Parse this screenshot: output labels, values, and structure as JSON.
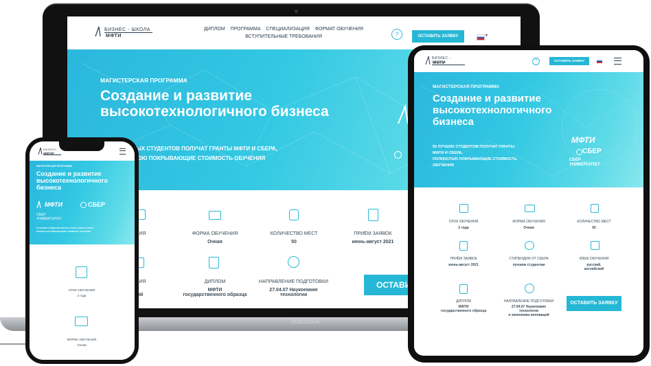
{
  "laptop": {
    "brand_label": "MacBook",
    "logo": {
      "line1": "БИЗНЕС - ШКОЛА",
      "line2": "МФТИ"
    },
    "nav": {
      "row1": [
        "ДИПЛОМ",
        "ПРОГРАММА",
        "СПЕЦИАЛИЗАЦИЯ",
        "ФОРМАТ ОБУЧЕНИЯ"
      ],
      "row2": [
        "ВСТУПИТЕЛЬНЫЕ ТРЕБОВАНИЯ"
      ]
    },
    "help_label": "?",
    "cta_label": "ОСТАВИТЬ ЗАЯВКУ",
    "program_label": "МАГИСТЕРСКАЯ ПРОГРАММА",
    "title_line1": "Создание и развитие",
    "title_line2": "высокотехнологичного бизнеса",
    "grants_line1": "ЫХ СТУДЕНТОВ ПОЛУЧАТ ГРАНТЫ МФТИ И СБЕРА,",
    "grants_line2": "ЮЮ ПОКРЫВАЮЩИЕ СТОИМОСТЬ ОБУЧЕНИЯ",
    "stats_row1": [
      {
        "label": "ЧЕНИЯ",
        "value": "да"
      },
      {
        "label": "ФОРМА ОБУЧЕНИЯ",
        "value": "Очная"
      },
      {
        "label": "КОЛИЧЕСТВО МЕСТ",
        "value": "50"
      },
      {
        "label": "ПРИЁМ ЗАЯВОК",
        "value": "июнь-август 2021"
      }
    ],
    "stats_row2": [
      {
        "label": "ЧЕНИЯ",
        "value": "кий,\nйский"
      },
      {
        "label": "ДИПЛОМ",
        "value": "МФТИ\nгосударственного образца"
      },
      {
        "label": "НАПРАВЛЕНИЕ ПОДГОТОВКИ",
        "value": "27.04.07 Наукоемкие\nтехнологии"
      }
    ],
    "big_cta": "ОСТАВИ"
  },
  "tablet": {
    "logo": {
      "line1": "БИЗНЕС - ШКОЛА",
      "line2": "МФТИ"
    },
    "help_label": "?",
    "cta_label": "ОСТАВИТЬ ЗАЯВКУ",
    "program_label": "МАГИСТЕРСКАЯ ПРОГРАММА",
    "title_line1": "Создание и развитие",
    "title_line2": "высокотехнологичного",
    "title_line3": "бизнеса",
    "partner_mipt": "МФТИ",
    "partner_sber": "СБЕР",
    "partner_sber_uni1": "СБЕР",
    "partner_sber_uni2": "УНИВЕРСИТЕТ",
    "grants": [
      "50 ЛУЧШИХ СТУДЕНТОВ ПОЛУЧАТ ГРАНТЫ",
      "МФТИ И СБЕРА,",
      "ПОЛНОСТЬЮ ПОКРЫВАЮЩИЕ СТОИМОСТЬ",
      "ОБУЧЕНИЯ"
    ],
    "stats": [
      {
        "label": "СРОК ОБУЧЕНИЯ",
        "value": "2 года"
      },
      {
        "label": "ФОРМА ОБУЧЕНИЯ",
        "value": "Очная"
      },
      {
        "label": "КОЛИЧЕСТВО МЕСТ",
        "value": "50"
      },
      {
        "label": "ПРИЁМ ЗАЯВОК",
        "value": "июнь-август 2021"
      },
      {
        "label": "СТИПЕНДИЯ ОТ СБЕРА",
        "value": "лучшим студентам"
      },
      {
        "label": "ЯЗЫК ОБУЧЕНИЯ",
        "value": "русский,\nанглийский"
      },
      {
        "label": "ДИПЛОМ",
        "value": "МФТИ\nгосударственного образца"
      },
      {
        "label": "НАПРАВЛЕНИЕ ПОДГОТОВКИ",
        "value": "27.04.07 Наукоемкие\nтехнологии\nи экономика инноваций"
      }
    ],
    "big_cta": "ОСТАВИТЬ ЗАЯВКУ"
  },
  "phone": {
    "logo": {
      "line1": "БИЗНЕС - ШКОЛА",
      "line2": "МФТИ"
    },
    "program_label": "МАГИСТЕРСКАЯ ПРОГРАММА",
    "title_line1": "Создание и развитие",
    "title_line2": "высокотехнологичного",
    "title_line3": "бизнеса",
    "partner_mipt": "МФТИ",
    "partner_sber": "СБЕР",
    "partner_sber_uni1": "СБЕР",
    "partner_sber_uni2": "УНИВЕРСИТЕТ",
    "grants_line1": "50 ЛУЧШИХ СТУДЕНТОВ ПОЛУЧАТ ГРАНТЫ МФТИ И СБЕРА,",
    "grants_line2": "ПОЛНОСТЬЮ ПОКРЫВАЮЩИЕ СТОИМОСТЬ ОБУЧЕНИЯ",
    "stats": [
      {
        "label": "СРОК ОБУЧЕНИЯ",
        "value": "2 года"
      },
      {
        "label": "ФОРМА ОБУЧЕНИЯ",
        "value": "Очная"
      }
    ]
  },
  "colors": {
    "accent": "#26b7d6",
    "dark": "#2b3b4a"
  }
}
